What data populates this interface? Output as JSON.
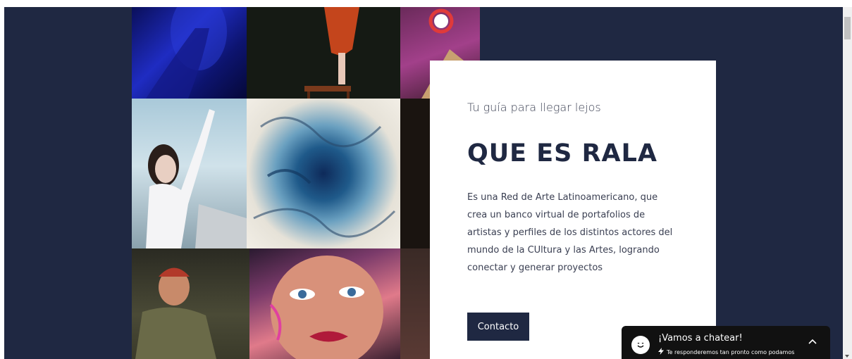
{
  "card": {
    "eyebrow": "Tu guía para llegar lejos",
    "heading": "QUE ES RALA",
    "body": "Es una Red de Arte Latinoamericano, que crea un banco virtual de portafolios de artistas y perfiles de los distintos actores del mundo de la CUltura y las Artes, logrando conectar y generar proyectos",
    "button": "Contacto"
  },
  "chat": {
    "title": "¡Vamos a chatear!",
    "subtitle": "Te responderemos tan pronto como podamos",
    "avatar_icon": "smile-icon",
    "bolt_icon": "bolt-icon",
    "toggle_icon": "chevron-up-icon"
  },
  "colors": {
    "page_background": "#1f2842",
    "card_background": "#ffffff",
    "button_background": "#1f2842",
    "chat_background": "#111111"
  },
  "collage": {
    "images": [
      "performer-blue-light",
      "dancer-on-stool",
      "stage-lights-pink",
      "woman-raised-arm",
      "blue-abstract-painting",
      "dark-portrait",
      "costumed-actor",
      "painted-face-portrait",
      "dark-scene"
    ]
  }
}
